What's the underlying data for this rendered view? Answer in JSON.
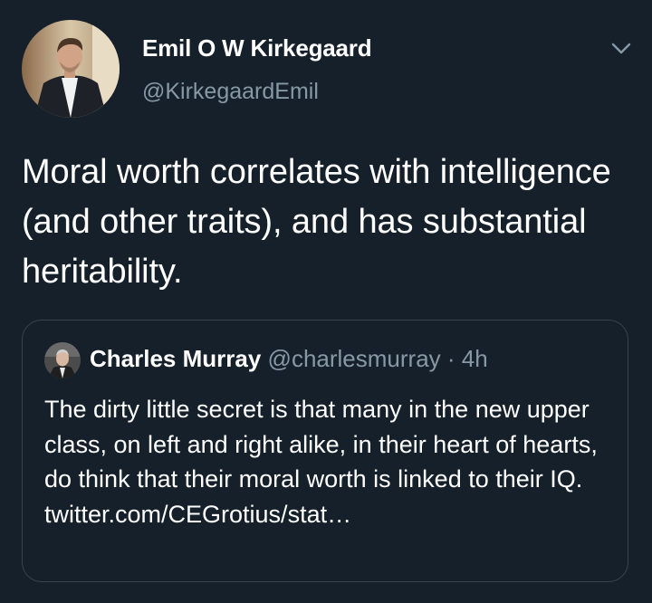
{
  "author": {
    "display_name": "Emil O W Kirkegaard",
    "handle": "@KirkegaardEmil",
    "avatar_icon": "profile-photo"
  },
  "menu_icon": "chevron-down-icon",
  "tweet": {
    "text": "Moral worth correlates with intelligence (and other traits), and has substantial heritability."
  },
  "quoted_tweet": {
    "display_name": "Charles Murray",
    "handle": "@charlesmurray",
    "separator": "·",
    "time": "4h",
    "text": "The dirty little secret is that many in the new upper class, on left and right alike, in their heart of hearts, do think that their moral worth is linked to their IQ. twitter.com/CEGrotius/stat…"
  },
  "colors": {
    "background": "#15202b",
    "primary_text": "#ffffff",
    "secondary_text": "#8899a6",
    "border": "#38444d"
  }
}
